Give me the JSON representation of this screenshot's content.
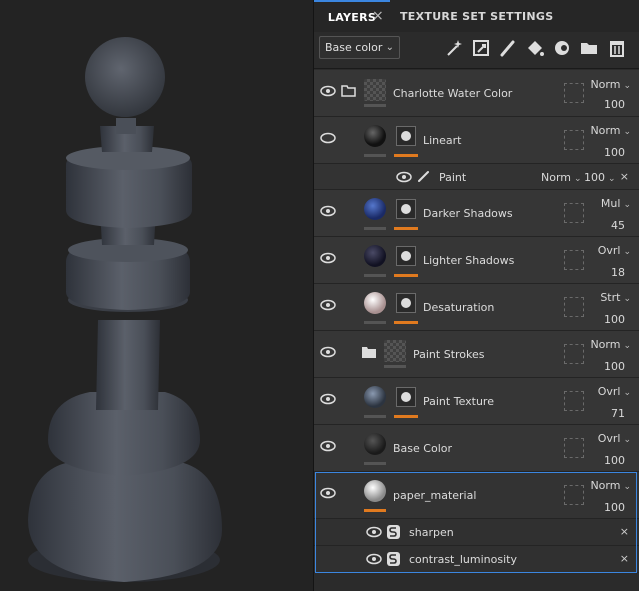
{
  "tabs": {
    "layers": "LAYERS",
    "close": "×",
    "texture_set": "TEXTURE SET SETTINGS"
  },
  "toolbar": {
    "channel_select": "Base color",
    "icons": [
      "add-effect-icon",
      "add-fill-layer-icon",
      "add-paint-layer-icon",
      "add-fill-icon",
      "add-mask-icon",
      "add-folder-icon",
      "delete-icon"
    ]
  },
  "layers": [
    {
      "name": "Charlotte Water Color",
      "blend": "Norm",
      "opacity": "100",
      "type": "folder",
      "eye": true
    },
    {
      "name": "Lineart",
      "blend": "Norm",
      "opacity": "100",
      "type": "fill",
      "eye": false
    },
    {
      "name": "Paint",
      "blend": "Norm",
      "opacity": "100",
      "type": "paint-sub",
      "eye": true
    },
    {
      "name": "Darker Shadows",
      "blend": "Mul",
      "opacity": "45",
      "type": "fill",
      "eye": true
    },
    {
      "name": "Lighter Shadows",
      "blend": "Ovrl",
      "opacity": "18",
      "type": "fill",
      "eye": true
    },
    {
      "name": "Desaturation",
      "blend": "Strt",
      "opacity": "100",
      "type": "fill",
      "eye": true
    },
    {
      "name": "Paint Strokes",
      "blend": "Norm",
      "opacity": "100",
      "type": "folder",
      "eye": true
    },
    {
      "name": "Paint Texture",
      "blend": "Ovrl",
      "opacity": "71",
      "type": "fill",
      "eye": true
    },
    {
      "name": "Base Color",
      "blend": "Ovrl",
      "opacity": "100",
      "type": "fill",
      "eye": true
    },
    {
      "name": "paper_material",
      "blend": "Norm",
      "opacity": "100",
      "type": "fill",
      "eye": true
    },
    {
      "name": "sharpen",
      "type": "filter",
      "eye": true
    },
    {
      "name": "contrast_luminosity",
      "type": "filter",
      "eye": true
    }
  ],
  "colors": {
    "accent": "#3b86e0",
    "mask_bar": "#e07a1f"
  }
}
